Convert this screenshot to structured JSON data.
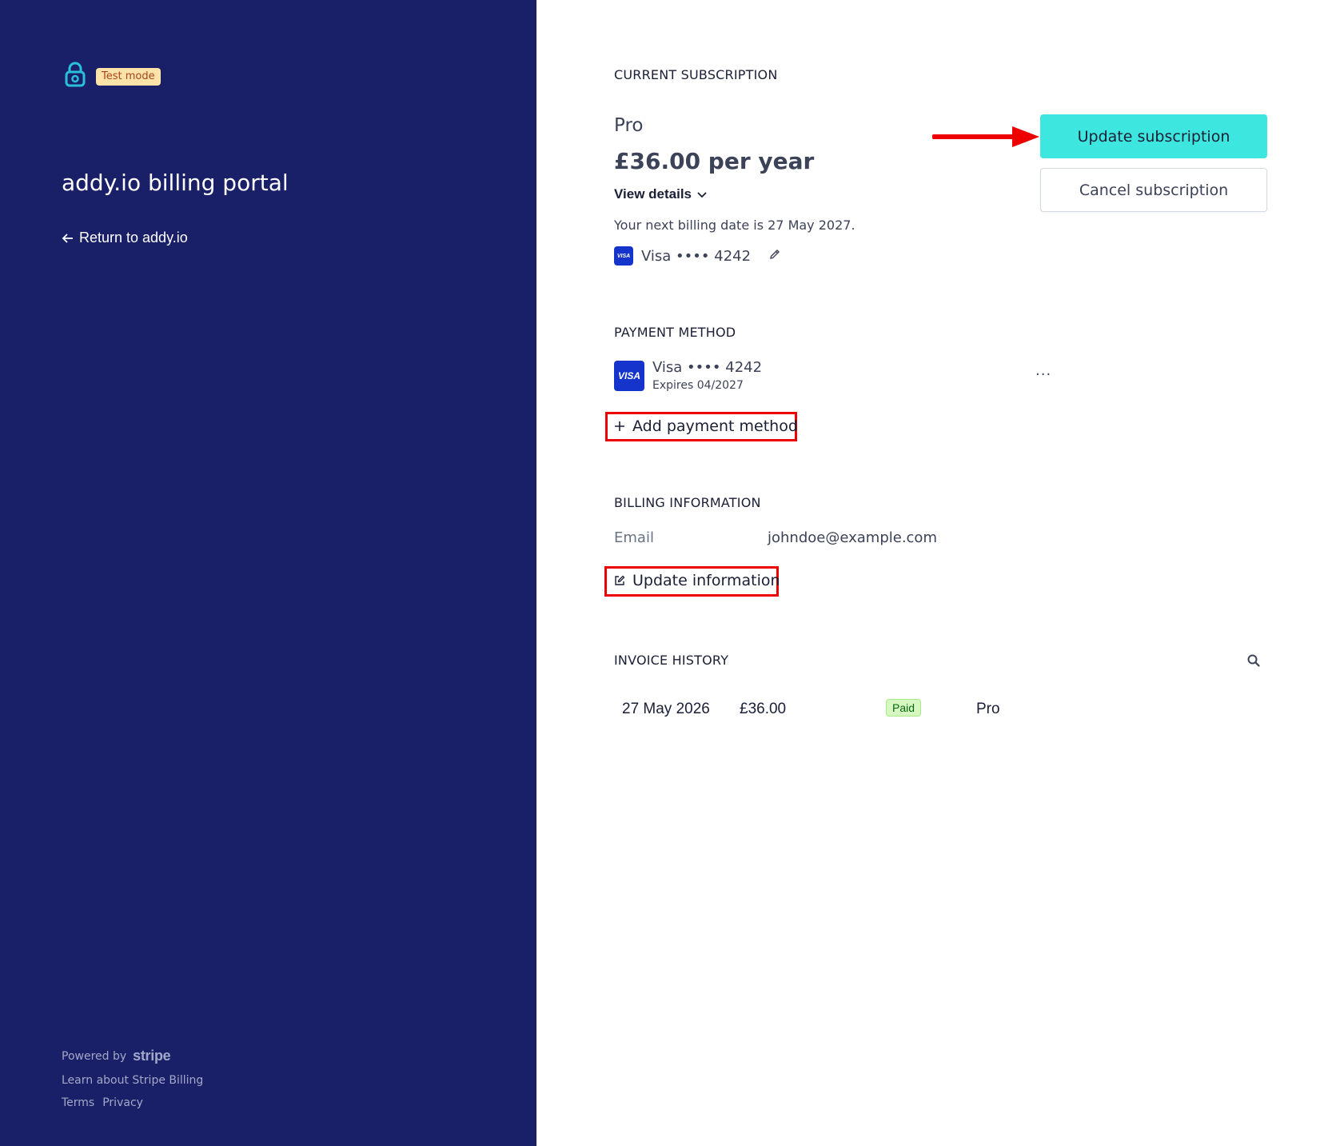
{
  "sidebar": {
    "test_mode_badge": "Test mode",
    "title": "addy.io billing portal",
    "return_link": "Return to addy.io",
    "footer": {
      "powered_by": "Powered by",
      "brand": "stripe",
      "learn": "Learn about Stripe Billing",
      "terms": "Terms",
      "privacy": "Privacy"
    }
  },
  "subscription": {
    "heading": "CURRENT SUBSCRIPTION",
    "plan": "Pro",
    "price": "£36.00 per year",
    "view_details": "View details",
    "next_billing": "Your next billing date is 27 May 2027.",
    "card": "Visa •••• 4242",
    "update_button": "Update subscription",
    "cancel_button": "Cancel subscription"
  },
  "payment_method": {
    "heading": "PAYMENT METHOD",
    "card_brand": "VISA",
    "card": "Visa •••• 4242",
    "expires": "Expires 04/2027",
    "more": "···",
    "add_label": "Add payment method"
  },
  "billing_info": {
    "heading": "BILLING INFORMATION",
    "email_label": "Email",
    "email_value": "johndoe@example.com",
    "update_label": "Update information"
  },
  "invoices": {
    "heading": "INVOICE HISTORY",
    "rows": [
      {
        "date": "27 May 2026",
        "amount": "£36.00",
        "status": "Paid",
        "plan": "Pro"
      }
    ]
  },
  "colors": {
    "sidebar_bg": "#1a2068",
    "accent": "#3ee6e0",
    "annotation": "#ee0000"
  }
}
